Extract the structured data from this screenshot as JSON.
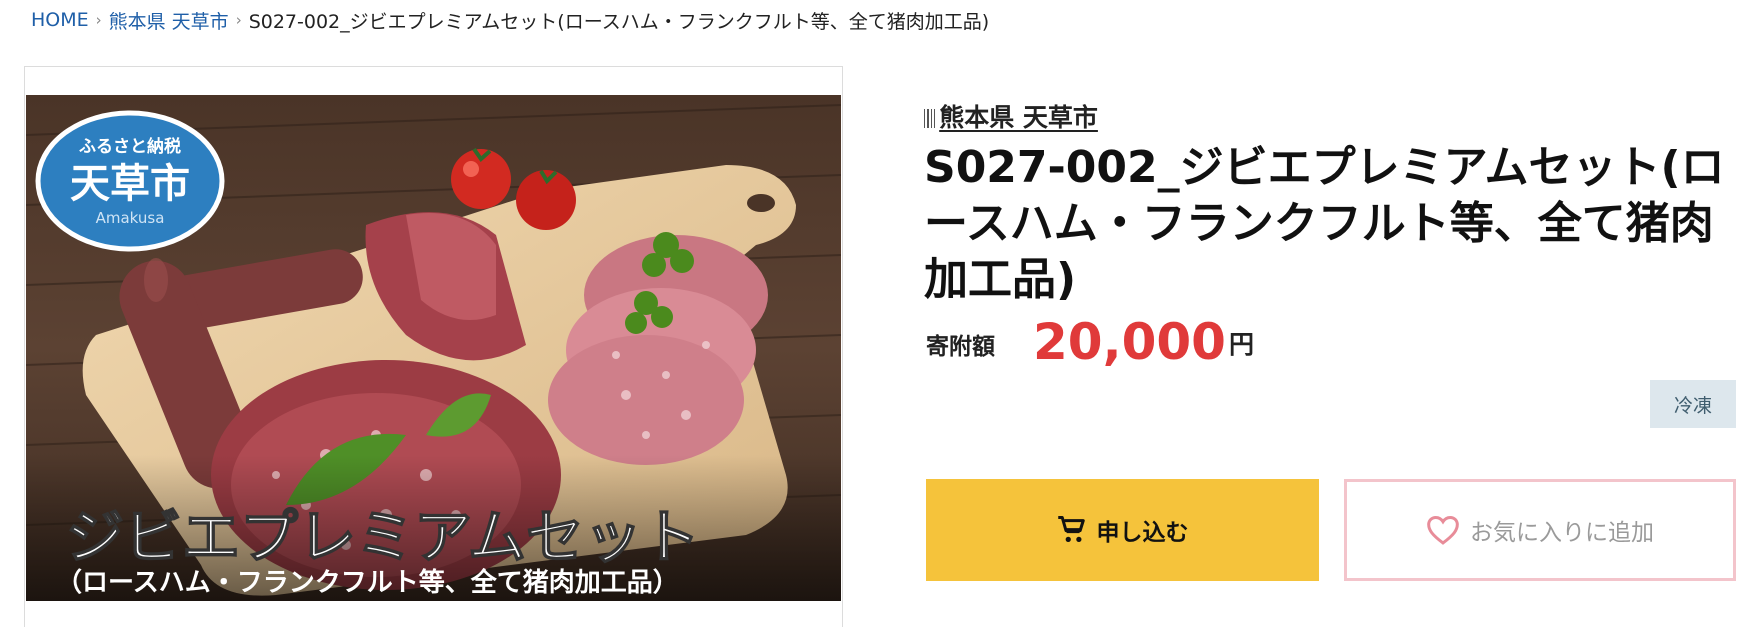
{
  "breadcrumb": {
    "home": "HOME",
    "separator": "›",
    "municipality": "熊本県 天草市",
    "current": "S027-002_ジビエプレミアムセット(ロースハム・フランクフルト等、全て猪肉加工品)"
  },
  "image": {
    "badge_top": "ふるさと納税",
    "badge_city": "天草市",
    "badge_roman": "Amakusa",
    "caption_main": "ジビエプレミアムセット",
    "caption_sub": "（ロースハム・フランクフルト等、全て猪肉加工品）"
  },
  "product": {
    "municipality": "熊本県 天草市",
    "title": "S027-002_ジビエプレミアムセット(ロースハム・フランクフルト等、全て猪肉加工品)",
    "price_label": "寄附額",
    "price_value": "20,000",
    "price_unit": "円",
    "badge": "冷凍"
  },
  "actions": {
    "apply_label": "申し込む",
    "favorite_label": "お気に入りに追加"
  },
  "icons": {
    "apply": "cart-icon",
    "favorite": "heart-icon"
  },
  "colors": {
    "link": "#1f5fa8",
    "price": "#e03a3a",
    "apply_button": "#f5c33b",
    "favorite_border": "#f3c4cb",
    "badge_bg": "#dde7ed"
  }
}
